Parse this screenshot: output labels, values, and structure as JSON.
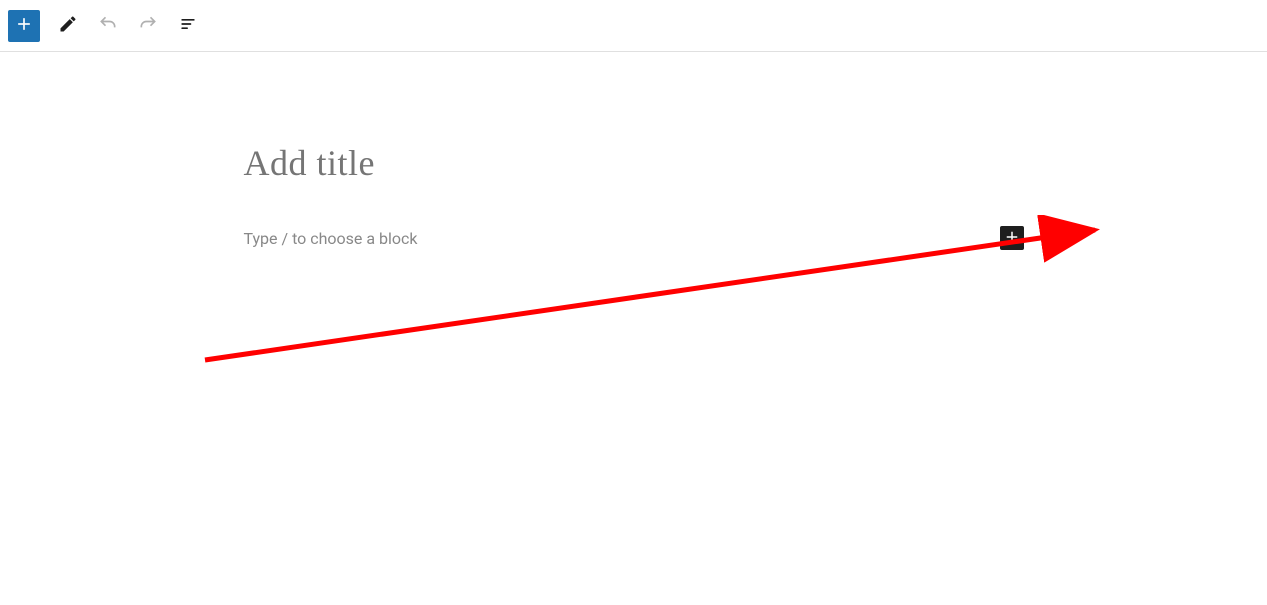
{
  "toolbar": {
    "add_block": "Add block",
    "edit_tools": "Tools",
    "undo": "Undo",
    "redo": "Redo",
    "outline": "Document outline"
  },
  "editor": {
    "title_placeholder": "Add title",
    "body_placeholder": "Type / to choose a block",
    "inline_add": "Add block"
  },
  "colors": {
    "primary": "#1e72b3",
    "annotation": "#ff0000"
  }
}
